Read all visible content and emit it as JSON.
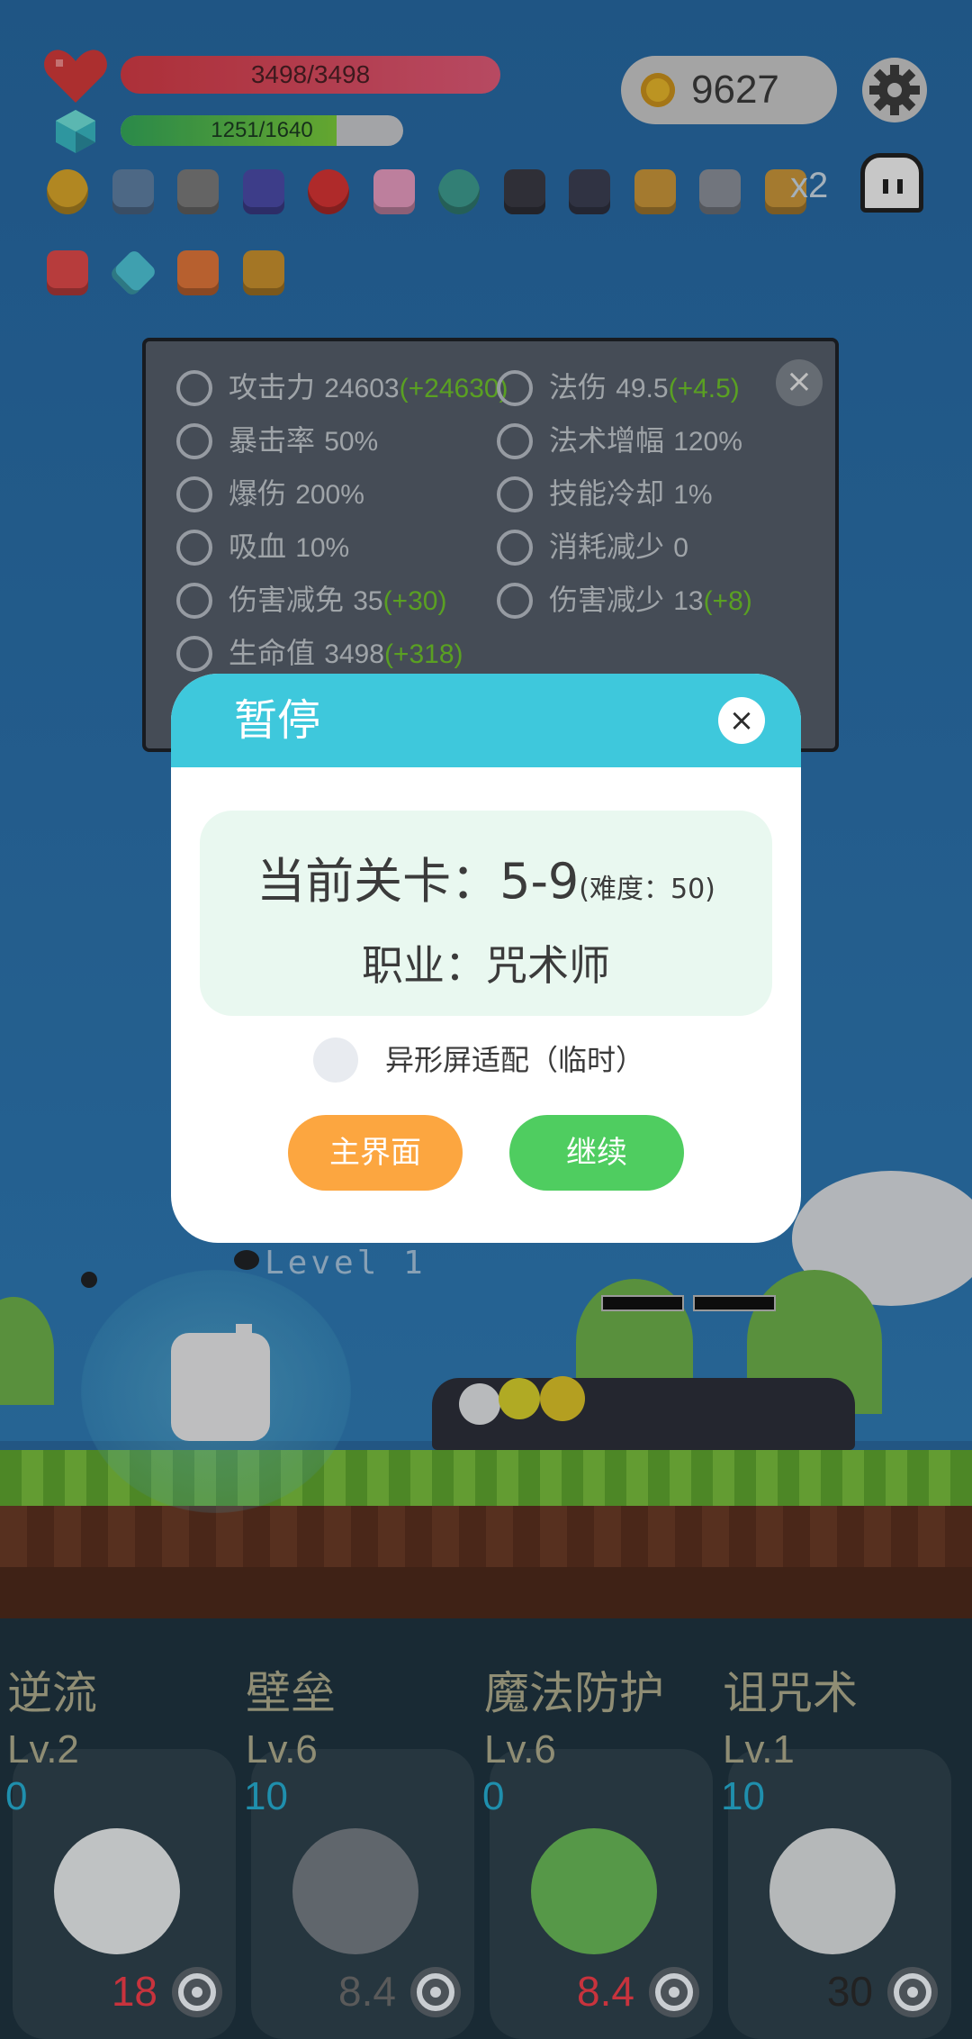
{
  "hud": {
    "hp_text": "3498/3498",
    "hp_fraction": 1.0,
    "mp_text": "1251/1640",
    "mp_fraction": 0.763,
    "coins": "9627",
    "speed": "x2",
    "icons": [
      "heart-icon",
      "crystal-icon",
      "gold-coin-icon",
      "settings-gear-icon",
      "ghost-icon"
    ],
    "items": [
      "ring",
      "shield",
      "spiked-mace",
      "wizard-hat",
      "apple",
      "ice-cream",
      "target-disc",
      "dark-book",
      "mortar-pestle",
      "fist-gauntlet",
      "spiked-mine",
      "fist-gauntlet",
      "pill-capsule",
      "diamond-gem",
      "fire-torch",
      "gold-book"
    ]
  },
  "stats": [
    {
      "icon": "axe-icon",
      "label": "攻击力",
      "value": "24603",
      "bonus": "(+24630)"
    },
    {
      "icon": "magic-sun-icon",
      "label": "法伤",
      "value": "49.5",
      "bonus": "(+4.5)"
    },
    {
      "icon": "crossed-swords-icon",
      "label": "暴击率",
      "value": "50%",
      "bonus": ""
    },
    {
      "icon": "lightning-icon",
      "label": "法术增幅",
      "value": "120%",
      "bonus": ""
    },
    {
      "icon": "burst-icon",
      "label": "爆伤",
      "value": "200%",
      "bonus": ""
    },
    {
      "icon": "hourglass-icon",
      "label": "技能冷却",
      "value": "1%",
      "bonus": ""
    },
    {
      "icon": "vampire-skull-icon",
      "label": "吸血",
      "value": "10%",
      "bonus": ""
    },
    {
      "icon": "magic-wand-icon",
      "label": "消耗减少",
      "value": "0",
      "bonus": ""
    },
    {
      "icon": "shield-icon",
      "label": "伤害减免",
      "value": "35",
      "bonus": "(+30)"
    },
    {
      "icon": "magic-shield-icon",
      "label": "伤害减少",
      "value": "13",
      "bonus": "(+8)"
    },
    {
      "icon": "heart-icon",
      "label": "生命值",
      "value": "3498",
      "bonus": "(+318)"
    }
  ],
  "modal": {
    "title": "暂停",
    "level_label": "当前关卡：",
    "level_value": "5-9",
    "difficulty": "(难度：50)",
    "job": "职业：咒术师",
    "checkbox_label": "异形屏适配（临时）",
    "btn_home": "主界面",
    "btn_continue": "继续",
    "close": "×"
  },
  "scene": {
    "float_text": "Level 1"
  },
  "skills": [
    {
      "name": "逆流",
      "level": "Lv.2",
      "cost": "0",
      "cooldown": "18",
      "cd_color": "#c8333d",
      "icon": "wing-icon"
    },
    {
      "name": "壁垒",
      "level": "Lv.6",
      "cost": "10",
      "cooldown": "8.4",
      "cd_color": "#5a5a5a",
      "icon": "armor-icon"
    },
    {
      "name": "魔法防护",
      "level": "Lv.6",
      "cost": "0",
      "cooldown": "8.4",
      "cd_color": "#c8333d",
      "icon": "leaf-icon"
    },
    {
      "name": "诅咒术",
      "level": "Lv.1",
      "cost": "10",
      "cooldown": "30",
      "cd_color": "#222222",
      "icon": "skull-icon"
    }
  ]
}
